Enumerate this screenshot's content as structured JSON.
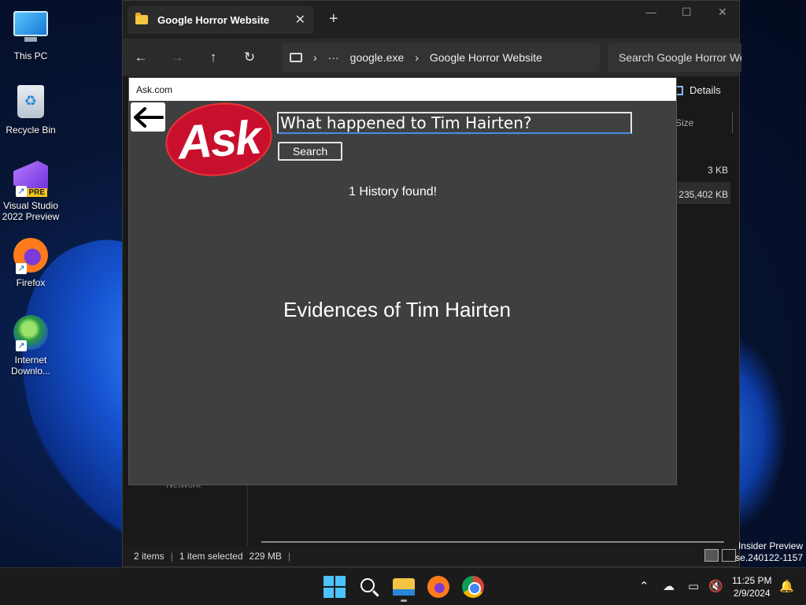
{
  "desktop": {
    "icons": [
      {
        "label": "This PC",
        "icon": "monitor-icon"
      },
      {
        "label": "Recycle Bin",
        "icon": "recycle-bin-icon"
      },
      {
        "label": "Visual Studio\n2022 Preview",
        "line1": "Visual Studio",
        "line2": "2022 Preview",
        "badge": "PRE",
        "icon": "visual-studio-icon"
      },
      {
        "label": "Firefox",
        "icon": "firefox-icon"
      },
      {
        "label": "Internet Downlo...",
        "line1": "Internet",
        "line2": "Downlo...",
        "icon": "idm-icon"
      }
    ]
  },
  "explorer": {
    "tab_title": "Google Horror Website",
    "new_tab": "+",
    "breadcrumb": {
      "more": "···",
      "segment1": "google.exe",
      "segment2": "Google Horror Website",
      "separator": "›"
    },
    "search_placeholder": "Search Google Horror We",
    "details_label": "Details",
    "column_size": "Size",
    "sizes": [
      "3 KB",
      "235,402 KB"
    ],
    "network_label": "Network",
    "status": {
      "items": "2 items",
      "selected": "1 item selected",
      "size": "229 MB",
      "sep": "|"
    }
  },
  "ask_app": {
    "window_title": "Ask.com",
    "logo_text": "Ask",
    "search_value": "What happened to Tim Hairten?",
    "search_button": "Search",
    "history_text": "1 History found!",
    "evidence_heading": "Evidences of Tim Hairten"
  },
  "watermark": {
    "line1": "Insider Preview",
    "line2": "se.240122-1157"
  },
  "taskbar": {
    "time": "11:25 PM",
    "date": "2/9/2024"
  },
  "colors": {
    "ask_red": "#c8102e",
    "ask_bg": "#3f3f3f",
    "win_accent": "#4cc2ff"
  }
}
